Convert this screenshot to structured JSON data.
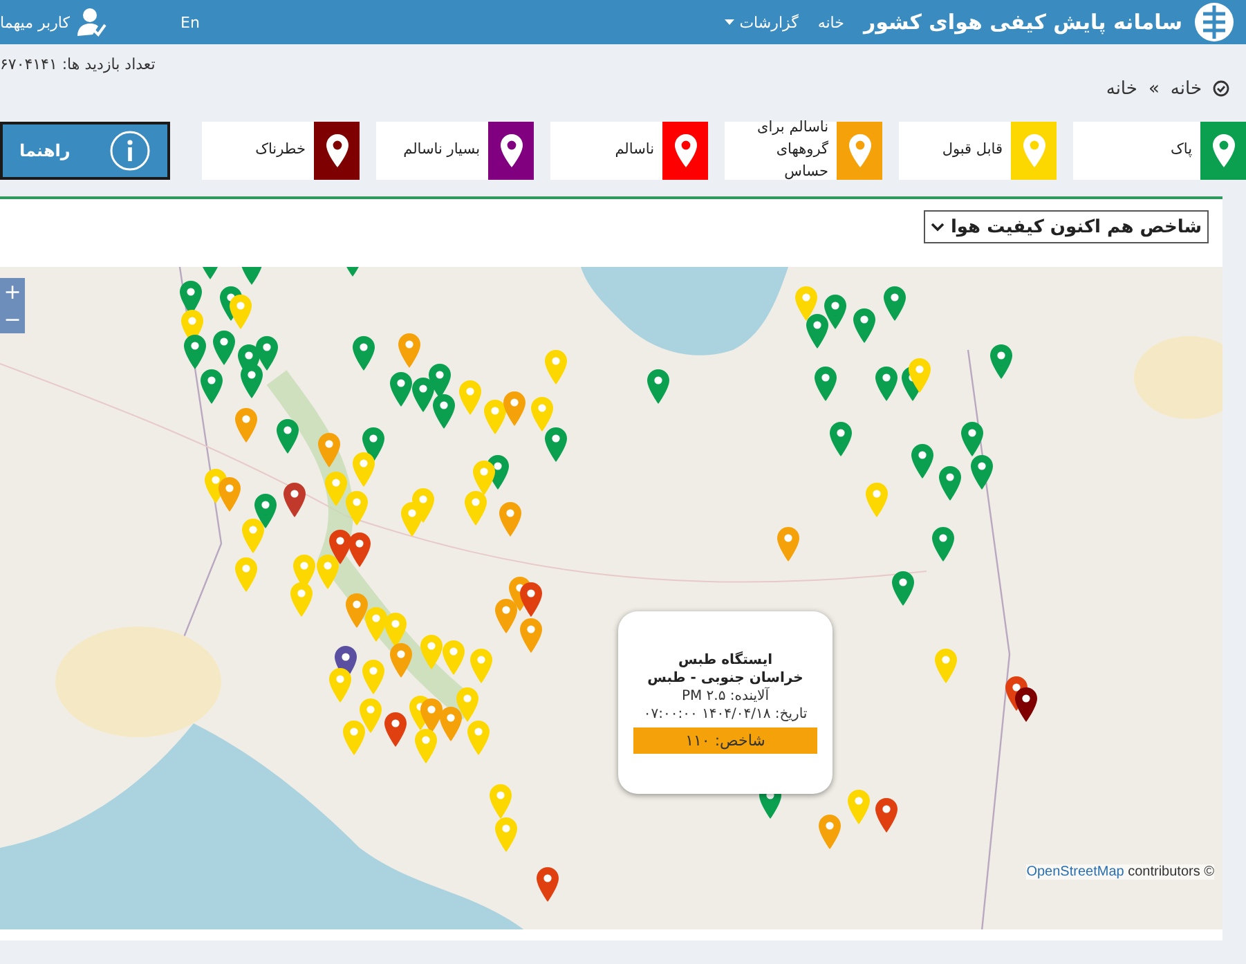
{
  "header": {
    "title": "سامانه پایش کیفی هوای کشور",
    "nav": [
      {
        "label": "خانه",
        "kind": "link"
      },
      {
        "label": "گزارشات",
        "kind": "dropdown"
      }
    ],
    "language": "En",
    "user": "کاربر میهما"
  },
  "visit_counter": "تعداد بازدید ها: ۶۷۰۴۱۴۱",
  "breadcrumb": [
    "خانه",
    "»",
    "خانه"
  ],
  "legend": [
    {
      "label": "پاک",
      "color": "#0aa050"
    },
    {
      "label": "قابل قبول",
      "color": "#fcd800"
    },
    {
      "label": "ناسالم برای گروههای حساس",
      "color": "#f5a20a"
    },
    {
      "label": "ناسالم",
      "color": "#ff0000"
    },
    {
      "label": "بسیار ناسالم",
      "color": "#800080"
    },
    {
      "label": "خطرناک",
      "color": "#7e0000"
    }
  ],
  "guide_button": "راهنما",
  "index_select": {
    "value": "شاخص هم اکنون کیفیت هوا"
  },
  "map": {
    "zoom_in": "+",
    "zoom_out": "−",
    "popup": {
      "station": "ایستگاه طبس",
      "location": "خراسان جنوبی - طبس",
      "pollutant": "آلاینده: PM ۲.۵",
      "date": "تاریخ: ۱۴۰۴/۰۴/۱۸ ۰۷:۰۰:۰۰",
      "index": "شاخص: ۱۱۰",
      "color": "#f5a20a"
    },
    "attribution": {
      "link": "OpenStreetMap",
      "text": "contributors ©"
    }
  }
}
